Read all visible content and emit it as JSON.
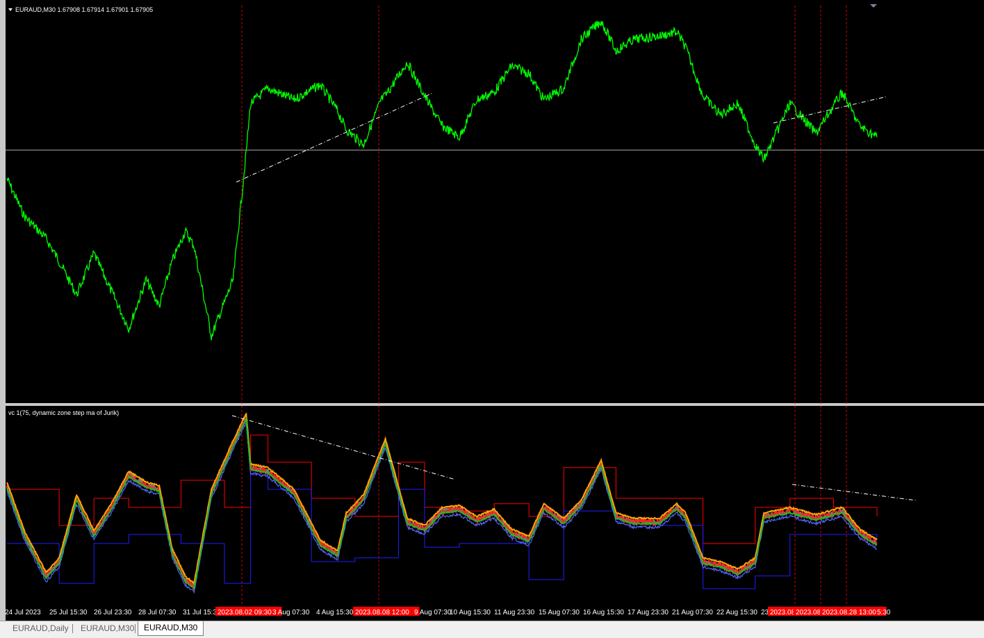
{
  "window": {
    "main_label": "EURAUD,M30  1.67908 1.67914 1.67901 1.67905",
    "indicator_label": "vc 1(75, dynamic zone step ma of Jurik)"
  },
  "tabs": [
    {
      "label": "EURAUD,Daily",
      "active": false
    },
    {
      "label": "EURAUD,M30",
      "active": false
    },
    {
      "label": "EURAUD,M30",
      "active": true
    }
  ],
  "chart_data": [
    {
      "type": "line",
      "title": "EURAUD,M30",
      "series": [
        {
          "name": "EURAUD,M30",
          "color": "#00ff00",
          "x": [
            0,
            0.02,
            0.045,
            0.06,
            0.08,
            0.1,
            0.12,
            0.14,
            0.16,
            0.175,
            0.19,
            0.205,
            0.215,
            0.235,
            0.26,
            0.275,
            0.28,
            0.3,
            0.33,
            0.36,
            0.38,
            0.39,
            0.41,
            0.43,
            0.435,
            0.46,
            0.48,
            0.5,
            0.52,
            0.54,
            0.56,
            0.58,
            0.6,
            0.617,
            0.64,
            0.66,
            0.683,
            0.7,
            0.72,
            0.75,
            0.77,
            0.78,
            0.8,
            0.82,
            0.84,
            0.86,
            0.87,
            0.9,
            0.93,
            0.96,
            0.98,
            1.0
          ],
          "y": [
            0.58,
            0.48,
            0.42,
            0.36,
            0.27,
            0.38,
            0.28,
            0.18,
            0.31,
            0.24,
            0.36,
            0.44,
            0.4,
            0.16,
            0.31,
            0.65,
            0.78,
            0.82,
            0.79,
            0.83,
            0.76,
            0.71,
            0.67,
            0.79,
            0.8,
            0.89,
            0.8,
            0.72,
            0.69,
            0.79,
            0.81,
            0.88,
            0.86,
            0.79,
            0.82,
            0.95,
            1.0,
            0.92,
            0.95,
            0.96,
            0.97,
            0.93,
            0.8,
            0.75,
            0.78,
            0.67,
            0.63,
            0.78,
            0.7,
            0.81,
            0.72,
            0.69
          ]
        },
        {
          "name": "Horizontal line",
          "color": "#c0c0c0",
          "y": [
            0.67
          ]
        }
      ]
    },
    {
      "type": "line",
      "title": "vc 1(75, dynamic zone step ma of Jurik)",
      "series": [
        {
          "name": "vc",
          "color": "#ff0000",
          "x": [
            0,
            0.02,
            0.045,
            0.06,
            0.08,
            0.1,
            0.12,
            0.14,
            0.16,
            0.175,
            0.19,
            0.205,
            0.215,
            0.235,
            0.26,
            0.275,
            0.28,
            0.3,
            0.33,
            0.36,
            0.38,
            0.39,
            0.41,
            0.43,
            0.435,
            0.46,
            0.48,
            0.5,
            0.52,
            0.54,
            0.56,
            0.58,
            0.6,
            0.617,
            0.64,
            0.66,
            0.683,
            0.7,
            0.72,
            0.75,
            0.77,
            0.78,
            0.8,
            0.82,
            0.84,
            0.86,
            0.87,
            0.9,
            0.93,
            0.96,
            0.98,
            1.0
          ],
          "y": [
            0.62,
            0.35,
            0.12,
            0.2,
            0.55,
            0.35,
            0.5,
            0.68,
            0.62,
            0.6,
            0.25,
            0.1,
            0.06,
            0.58,
            0.85,
            1.0,
            0.72,
            0.7,
            0.58,
            0.3,
            0.24,
            0.45,
            0.55,
            0.8,
            0.86,
            0.42,
            0.38,
            0.48,
            0.49,
            0.43,
            0.47,
            0.36,
            0.32,
            0.5,
            0.42,
            0.52,
            0.74,
            0.45,
            0.42,
            0.42,
            0.5,
            0.45,
            0.2,
            0.18,
            0.14,
            0.2,
            0.45,
            0.48,
            0.44,
            0.48,
            0.36,
            0.3
          ]
        },
        {
          "name": "Upper zone",
          "color": "#ff0000",
          "x": [
            0,
            0.06,
            0.1,
            0.14,
            0.2,
            0.25,
            0.28,
            0.3,
            0.35,
            0.4,
            0.45,
            0.48,
            0.52,
            0.56,
            0.6,
            0.64,
            0.7,
            0.75,
            0.8,
            0.86,
            0.9,
            0.95,
            1.0
          ],
          "y": [
            0.6,
            0.4,
            0.55,
            0.5,
            0.65,
            0.5,
            0.9,
            0.75,
            0.55,
            0.45,
            0.75,
            0.5,
            0.48,
            0.52,
            0.45,
            0.72,
            0.55,
            0.55,
            0.3,
            0.5,
            0.55,
            0.5,
            0.45
          ]
        },
        {
          "name": "Lower zone",
          "color": "#1e1eff",
          "x": [
            0,
            0.06,
            0.1,
            0.14,
            0.2,
            0.25,
            0.28,
            0.3,
            0.35,
            0.4,
            0.45,
            0.48,
            0.52,
            0.56,
            0.6,
            0.64,
            0.7,
            0.75,
            0.8,
            0.86,
            0.9,
            0.95,
            1.0
          ],
          "y": [
            0.3,
            0.08,
            0.3,
            0.35,
            0.3,
            0.08,
            0.68,
            0.6,
            0.2,
            0.22,
            0.6,
            0.28,
            0.3,
            0.3,
            0.1,
            0.48,
            0.42,
            0.4,
            0.05,
            0.12,
            0.35,
            0.35,
            0.32
          ]
        }
      ]
    }
  ],
  "x_ticks": [
    "24 Jul 2023",
    "25 Jul 15:30",
    "26 Jul 23:30",
    "28 Jul 07:30",
    "31 Jul 15:30",
    "2023.08.02 09:30",
    "3 Aug 07:30",
    "4 Aug 15:30",
    "2023.08.08 12:00",
    "9 Aug 07:30",
    "10 Aug 15:30",
    "11 Aug 23:30",
    "15 Aug 07:30",
    "16 Aug 15:30",
    "17 Aug 23:30",
    "21 Aug 07:30",
    "22 Aug 15:30",
    "23",
    "2023.08",
    "2023.08",
    "2023.08.28 13:00",
    "5:30"
  ],
  "x_highlighted": [
    "2023.08.02 09:30",
    "2023.08.08 12:00",
    "2023.08",
    "2023.08",
    "2023.08.28 13:00"
  ],
  "colors": {
    "background": "#000000",
    "price": "#00ff00",
    "vline": "#e00000",
    "trendline": "#ffffff",
    "axis_text": "#ffffff",
    "highlight_bg": "#ff0000"
  }
}
